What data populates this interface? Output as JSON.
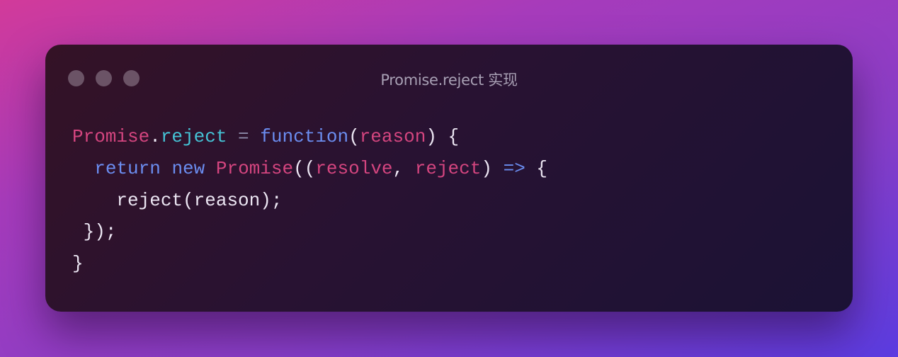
{
  "window": {
    "title": "Promise.reject 实现"
  },
  "code": {
    "line1": {
      "t1": "Promise",
      "t2": ".",
      "t3": "reject",
      "t4": " = ",
      "t5": "function",
      "t6": "(",
      "t7": "reason",
      "t8": ") {"
    },
    "line2": {
      "indent": "  ",
      "t1": "return",
      "t2": " ",
      "t3": "new",
      "t4": " ",
      "t5": "Promise",
      "t6": "((",
      "t7": "resolve",
      "t8": ", ",
      "t9": "reject",
      "t10": ") ",
      "t11": "=>",
      "t12": " {"
    },
    "line3": {
      "indent": "    ",
      "t1": "reject(reason);"
    },
    "line4": {
      "indent": " ",
      "t1": "});"
    },
    "line5": {
      "t1": "}"
    }
  },
  "colors": {
    "background_start": "#d23a9a",
    "background_end": "#5b3ce0",
    "window_bg": "#2a1230",
    "keyword_pink": "#d4457f",
    "method_cyan": "#45c3d6",
    "keyword_blue": "#6b8df0",
    "text_white": "#ece6f3",
    "traffic_dot": "#6b5366"
  }
}
